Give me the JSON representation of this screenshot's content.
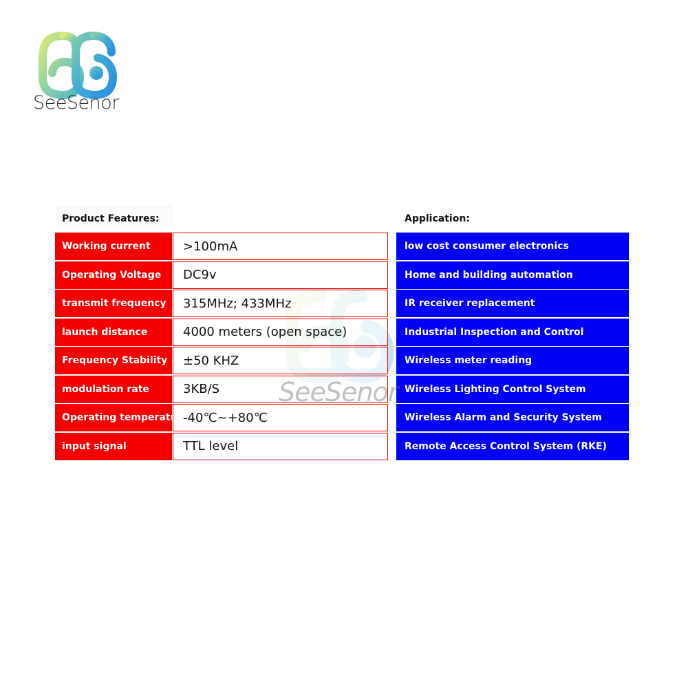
{
  "brand": {
    "name": "SeeSenor",
    "logo_icon": "seesenor-logo-icon"
  },
  "features": {
    "title": "Product Features:",
    "label_color": "#f50000",
    "border_color": "#ee0000",
    "rows": [
      {
        "label": "Working current",
        "value": ">100mA"
      },
      {
        "label": "Operating Voltage",
        "value": "DC9v"
      },
      {
        "label": "transmit frequency",
        "value": "315MHz; 433MHz"
      },
      {
        "label": "launch distance",
        "value": "4000 meters (open space)"
      },
      {
        "label": "Frequency Stability",
        "value": "±50 KHZ"
      },
      {
        "label": "modulation rate",
        "value": "3KB/S"
      },
      {
        "label": "Operating temperature",
        "value": "-40℃~+80℃"
      },
      {
        "label": "input signal",
        "value": "TTL level"
      }
    ]
  },
  "application": {
    "title": "Application:",
    "color": "#0000f5",
    "items": [
      "low cost consumer electronics",
      "Home and building automation",
      "IR receiver replacement",
      "Industrial Inspection and Control",
      "Wireless meter reading",
      "Wireless Lighting Control System",
      "Wireless Alarm and Security System",
      "Remote Access Control System (RKE)"
    ]
  },
  "watermark": {
    "text": "SeeSenor"
  }
}
